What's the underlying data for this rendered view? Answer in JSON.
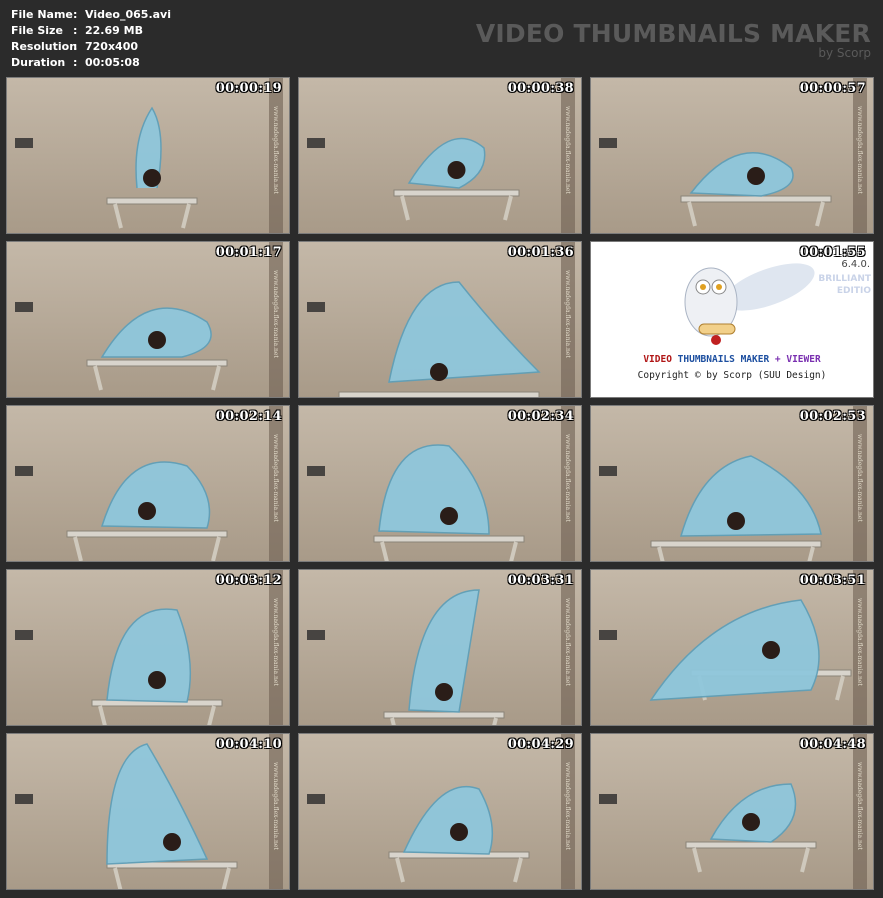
{
  "header": {
    "info": [
      {
        "key": "File Name",
        "sep": ":",
        "value": "Video_065.avi"
      },
      {
        "key": "File Size",
        "sep": ":",
        "value": "22.69 MB"
      },
      {
        "key": "Resolution",
        "sep": ":",
        "value": "720x400"
      },
      {
        "key": "Duration",
        "sep": ":",
        "value": "00:05:08"
      }
    ],
    "brand_title": "VIDEO THUMBNAILS MAKER",
    "brand_sub": "by Scorp"
  },
  "thumbnails": [
    {
      "time": "00:00:19",
      "watermark": "www.nadegda.flex-mania.net"
    },
    {
      "time": "00:00:38",
      "watermark": "www.nadegda.flex-mania.net"
    },
    {
      "time": "00:00:57",
      "watermark": "www.nadegda.flex-mania.net"
    },
    {
      "time": "00:01:17",
      "watermark": "www.nadegda.flex-mania.net"
    },
    {
      "time": "00:01:36",
      "watermark": "www.nadegda.flex-mania.net"
    },
    {
      "time": "00:01:55"
    },
    {
      "time": "00:02:14",
      "watermark": "www.nadegda.flex-mania.net"
    },
    {
      "time": "00:02:34",
      "watermark": "www.nadegda.flex-mania.net"
    },
    {
      "time": "00:02:53",
      "watermark": "www.nadegda.flex-mania.net"
    },
    {
      "time": "00:03:12",
      "watermark": "www.nadegda.flex-mania.net"
    },
    {
      "time": "00:03:31",
      "watermark": "www.nadegda.flex-mania.net"
    },
    {
      "time": "00:03:51",
      "watermark": "www.nadegda.flex-mania.net"
    },
    {
      "time": "00:04:10",
      "watermark": "www.nadegda.flex-mania.net"
    },
    {
      "time": "00:04:29",
      "watermark": "www.nadegda.flex-mania.net"
    },
    {
      "time": "00:04:48",
      "watermark": "www.nadegda.flex-mania.net"
    }
  ],
  "logo": {
    "version": "6.4.0.",
    "edition_line1": "BRILLIANT",
    "edition_line2": "EDITIO",
    "title_part1": "VIDEO",
    "title_part2": "THUMBNAILS MAKER",
    "title_part3": "+ VIEWER",
    "copyright": "Copyright © by Scorp (SUU Design)"
  },
  "colors": {
    "background": "#2b2b2b",
    "brand_text": "#5a5a5a",
    "leotard": "#8fc7dc",
    "wall": "#bcb0a0"
  }
}
